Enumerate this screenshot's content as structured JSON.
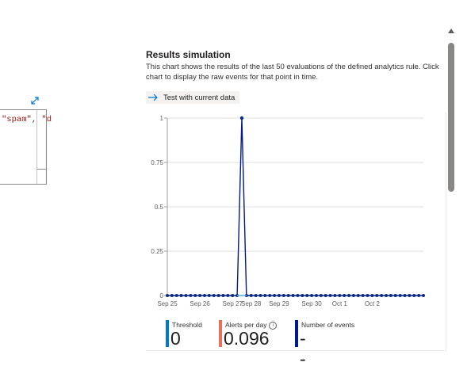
{
  "editor": {
    "code_open_quote": "\"spam\"",
    "code_sep": ", ",
    "code_next": "\"d"
  },
  "icons": {
    "expand": "expand-icon",
    "arrow": "arrow-right-icon",
    "info": "info-icon"
  },
  "results": {
    "title": "Results simulation",
    "description": "This chart shows the results of the last 50 evaluations of the defined analytics rule. Click chart to display the raw events for that point in time.",
    "test_button_label": "Test with current data"
  },
  "legend": [
    {
      "label": "Threshold",
      "value": "0",
      "color": "#0078d4"
    },
    {
      "label": "Alerts per day",
      "value": "0.096",
      "color": "#e8715a",
      "has_info": true
    },
    {
      "label": "Number of events",
      "value": "--",
      "color": "#001a8c"
    }
  ],
  "chart_data": {
    "type": "line",
    "y_ticks": [
      "0",
      "0.25",
      "0.5",
      "0.75",
      "1"
    ],
    "ylim": [
      0,
      1
    ],
    "x_tick_labels": [
      "Sep 25",
      "Sep 26",
      "Sep 27",
      "Sep 28",
      "Sep 29",
      "Sep 30",
      "Oct 1",
      "Oct 2"
    ],
    "x_tick_index": [
      0,
      7,
      14,
      18,
      24,
      31,
      37,
      44
    ],
    "grid": true,
    "line_color": "#001a8c",
    "marker_color": "#0b2a8a",
    "highlight_color": "#59b4d9",
    "highlight_index": 16,
    "series": [
      {
        "values": [
          0,
          0,
          0,
          0,
          0,
          0,
          0,
          0,
          0,
          0,
          0,
          0,
          0,
          0,
          0,
          0,
          1,
          0,
          0,
          0,
          0,
          0,
          0,
          0,
          0,
          0,
          0,
          0,
          0,
          0,
          0,
          0,
          0,
          0,
          0,
          0,
          0,
          0,
          0,
          0,
          0,
          0,
          0,
          0,
          0,
          0,
          0,
          0,
          0,
          0,
          0,
          0,
          0,
          0,
          0,
          0
        ]
      }
    ]
  }
}
